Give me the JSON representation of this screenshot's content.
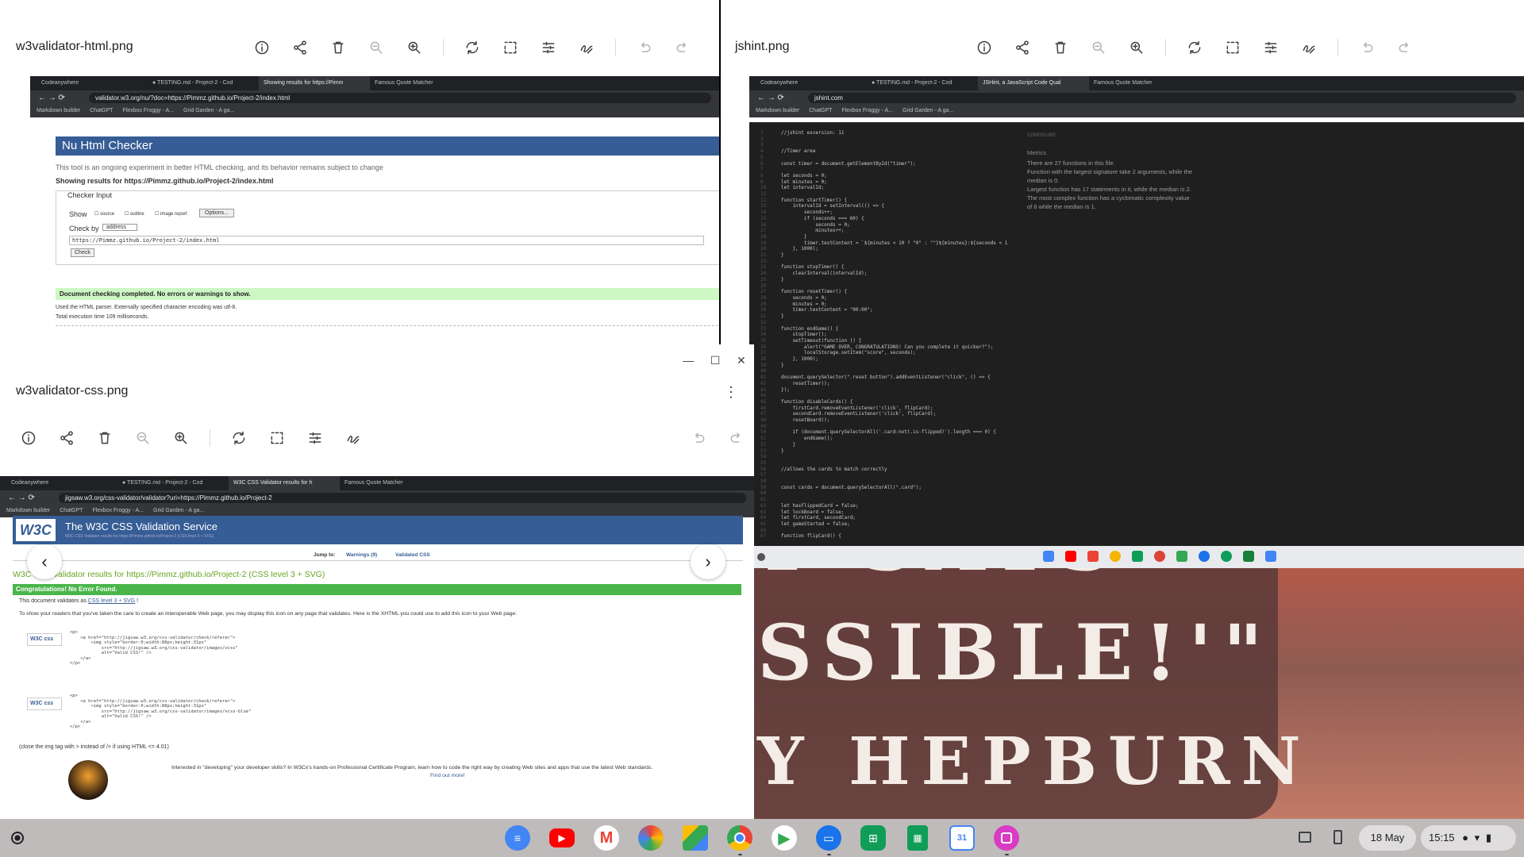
{
  "windows": {
    "html_validator": {
      "title": "w3validator-html.png",
      "browser": {
        "tabs": [
          "Codeanywhere",
          "● TESTING.md - Project-2 - Cod",
          "Showing results for https://Pimm",
          "Famous Quote Matcher"
        ],
        "url": "validator.w3.org/nu/?doc=https://Pimmz.github.io/Project-2/index.html",
        "bookmarks": [
          "Markdown builder",
          "ChatGPT",
          "Flexbox Froggy - A...",
          "Grid Garden - A ga..."
        ]
      },
      "page": {
        "heading": "Nu Html Checker",
        "notice": "This tool is an ongoing experiment in better HTML checking, and its behavior remains subject to change",
        "results_for": "Showing results for https://Pimmz.github.io/Project-2/index.html",
        "checker_input": "Checker Input",
        "show_label": "Show",
        "options": [
          "source",
          "outline",
          "image report"
        ],
        "options_button": "Options...",
        "check_by": "Check by",
        "check_by_value": "address",
        "input_value": "https://Pimmz.github.io/Project-2/index.html",
        "check_button": "Check",
        "success": "Document checking completed. No errors or warnings to show.",
        "encoding": "Used the HTML parser. Externally specified character encoding was utf-8.",
        "time": "Total execution time 109 milliseconds."
      }
    },
    "jshint": {
      "title": "jshint.png",
      "browser": {
        "tabs": [
          "Codeanywhere",
          "● TESTING.md - Project-2 - Cod",
          "JSHint, a JavaScript Code Qual",
          "Famous Quote Matcher"
        ],
        "url": "jshint.com",
        "bookmarks": [
          "Markdown builder",
          "ChatGPT",
          "Flexbox Froggy - A...",
          "Grid Garden - A ga..."
        ]
      },
      "metrics": {
        "config": "CONFIGURE",
        "heading": "Metrics",
        "lines": [
          "There are 27 functions in this file.",
          "Function with the largest signature take 2 arguments, while the median is 0.",
          "Largest function has 17 statements in it, while the median is 2.",
          "The most complex function has a cyclomatic complexity value of 6 while the median is 1."
        ]
      },
      "code_lines": [
        "//jshint esversion: 11",
        "",
        "",
        "//Timer area",
        "",
        "const timer = document.getElementById(\"timer\");",
        "",
        "let seconds = 0;",
        "let minutes = 0;",
        "let intervalId;",
        "",
        "function startTimer() {",
        "    intervalId = setInterval(() => {",
        "        seconds++;",
        "        if (seconds === 60) {",
        "            seconds = 0;",
        "            minutes++;",
        "        }",
        "        timer.textContent = `${minutes < 10 ? \"0\" : \"\"}${minutes}:${seconds < 1",
        "    }, 1000);",
        "}",
        "",
        "function stopTimer() {",
        "    clearInterval(intervalId);",
        "}",
        "",
        "function resetTimer() {",
        "    seconds = 0;",
        "    minutes = 0;",
        "    timer.textContent = \"00:00\";",
        "}",
        "",
        "function endGame() {",
        "    stopTimer();",
        "    setTimeout(function () {",
        "        alert(\"GAME OVER, CONGRATULATIONS! Can you complete it quicker?\");",
        "        localStorage.setItem(\"score\", seconds);",
        "    }, 1000);",
        "}",
        "",
        "document.querySelector(\".reset button\").addEventListener(\"click\", () => {",
        "    resetTimer();",
        "});",
        "",
        "function disableCards() {",
        "    firstCard.removeEventListener('click', flipCard);",
        "    secondCard.removeEventListener('click', flipCard);",
        "    resetBoard();",
        "",
        "    if (document.querySelectorAll('.card:not(.is-flipped)').length === 0) {",
        "        endGame();",
        "    }",
        "}",
        "",
        "",
        "//allows the cards to match correctly",
        "",
        "",
        "const cards = document.querySelectorAll(\".card\");",
        "",
        "",
        "let hasFlippedCard = false;",
        "let lockBoard = false;",
        "let firstCard, secondCard;",
        "let gameStarted = false;",
        "",
        "function flipCard() {"
      ]
    },
    "css_validator": {
      "title": "w3validator-css.png",
      "browser": {
        "tabs": [
          "Codeanywhere",
          "● TESTING.md - Project-2 - Cod",
          "W3C CSS Validator results for h",
          "Famous Quote Matcher"
        ],
        "url": "jigsaw.w3.org/css-validator/validator?uri=https://Pimmz.github.io/Project-2",
        "bookmarks": [
          "Markdown builder",
          "ChatGPT",
          "Flexbox Froggy - A...",
          "Grid Garden - A ga..."
        ]
      },
      "page": {
        "logo": "W3C",
        "heading": "The W3C CSS Validation Service",
        "subheading": "W3C CSS Validator results for https://Pimmz.github.io/Project-2 (CSS level 3 + SVG)",
        "jump_to": "Jump to:",
        "warnings_link": "Warnings (9)",
        "validated_link": "Validated CSS",
        "results_title": "W3C CSS Validator results for https://Pimmz.github.io/Project-2 (CSS level 3 + SVG)",
        "congrats": "Congratulations! No Error Found.",
        "validates_prefix": "This document validates as",
        "validates_link": "CSS level 3 + SVG",
        "validates_suffix": "!",
        "explain": "To show your readers that you've taken the care to create an interoperable Web page, you may display this icon on any page that validates. Here is the XHTML you could use to add this icon to your Web page:",
        "badge1": "W3C css",
        "badge2": "W3C css",
        "snippet1": "<p>\n    <a href=\"http://jigsaw.w3.org/css-validator/check/referer\">\n        <img style=\"border:0;width:88px;height:31px\"\n            src=\"http://jigsaw.w3.org/css-validator/images/vcss\"\n            alt=\"Valid CSS!\" />\n    </a>\n</p>",
        "snippet2": "<p>\n    <a href=\"http://jigsaw.w3.org/css-validator/check/referer\">\n        <img style=\"border:0;width:88px;height:31px\"\n            src=\"http://jigsaw.w3.org/css-validator/images/vcss-blue\"\n            alt=\"Valid CSS!\" />\n    </a>\n</p>",
        "close_tag": "(close the img tag with > instead of /> if using HTML <= 4.01)",
        "interested": "Interested in \"developing\" your developer skills? In W3Cx's hands-on Professional Certificate Program, learn how to code the right way by creating Web sites and apps that use the latest Web standards.",
        "find_out": "Find out more!"
      }
    },
    "quote": {
      "line1": "T SAYS",
      "line2": "SSIBLE!'\"",
      "line3": "Y HEPBURN"
    }
  },
  "status": {
    "date": "18 May",
    "time": "15:15"
  },
  "colors": {
    "validator_blue": "#365d95",
    "success_green": "#cdf7c3",
    "css_green_bar": "#4ab54a",
    "css_result_green": "#67a520"
  }
}
